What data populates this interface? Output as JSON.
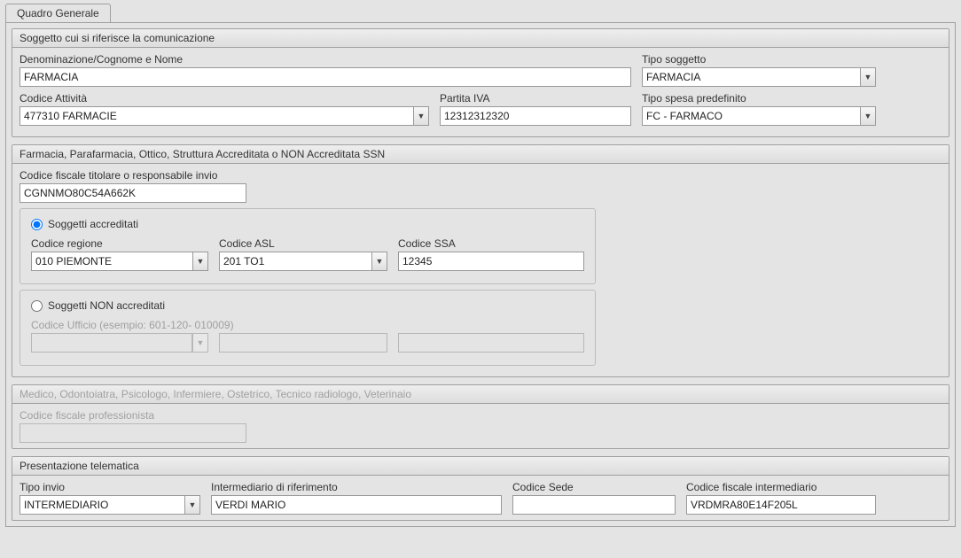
{
  "tabs": {
    "general": "Quadro Generale"
  },
  "s1": {
    "title": "Soggetto cui si riferisce la comunicazione",
    "denominazione_label": "Denominazione/Cognome e Nome",
    "denominazione_value": "FARMACIA",
    "tipo_soggetto_label": "Tipo soggetto",
    "tipo_soggetto_value": "FARMACIA",
    "codice_attivita_label": "Codice Attività",
    "codice_attivita_value": "477310 FARMACIE",
    "partita_iva_label": "Partita IVA",
    "partita_iva_value": "12312312320",
    "tipo_spesa_label": "Tipo spesa predefinito",
    "tipo_spesa_value": "FC - FARMACO"
  },
  "s2": {
    "title": "Farmacia, Parafarmacia, Ottico,  Struttura Accreditata o NON Accreditata SSN",
    "cf_titolare_label": "Codice fiscale titolare o responsabile invio",
    "cf_titolare_value": "CGNNMO80C54A662K",
    "radio_acc": "Soggetti accreditati",
    "radio_nonacc": "Soggetti NON accreditati",
    "codice_regione_label": "Codice regione",
    "codice_regione_value": "010 PIEMONTE",
    "codice_asl_label": "Codice ASL",
    "codice_asl_value": "201 TO1",
    "codice_ssa_label": "Codice SSA",
    "codice_ssa_value": "12345",
    "codice_ufficio_label": "Codice Ufficio (esempio: 601-120- 010009)"
  },
  "s3": {
    "title": "Medico, Odontoiatra, Psicologo, Infermiere, Ostetrico, Tecnico radiologo, Veterinaio",
    "cf_prof_label": "Codice fiscale professionista"
  },
  "s4": {
    "title": "Presentazione telematica",
    "tipo_invio_label": "Tipo invio",
    "tipo_invio_value": "INTERMEDIARIO",
    "intermediario_label": "Intermediario di riferimento",
    "intermediario_value": "VERDI MARIO",
    "codice_sede_label": "Codice Sede",
    "codice_sede_value": "",
    "cf_inter_label": "Codice fiscale intermediario",
    "cf_inter_value": "VRDMRA80E14F205L"
  }
}
